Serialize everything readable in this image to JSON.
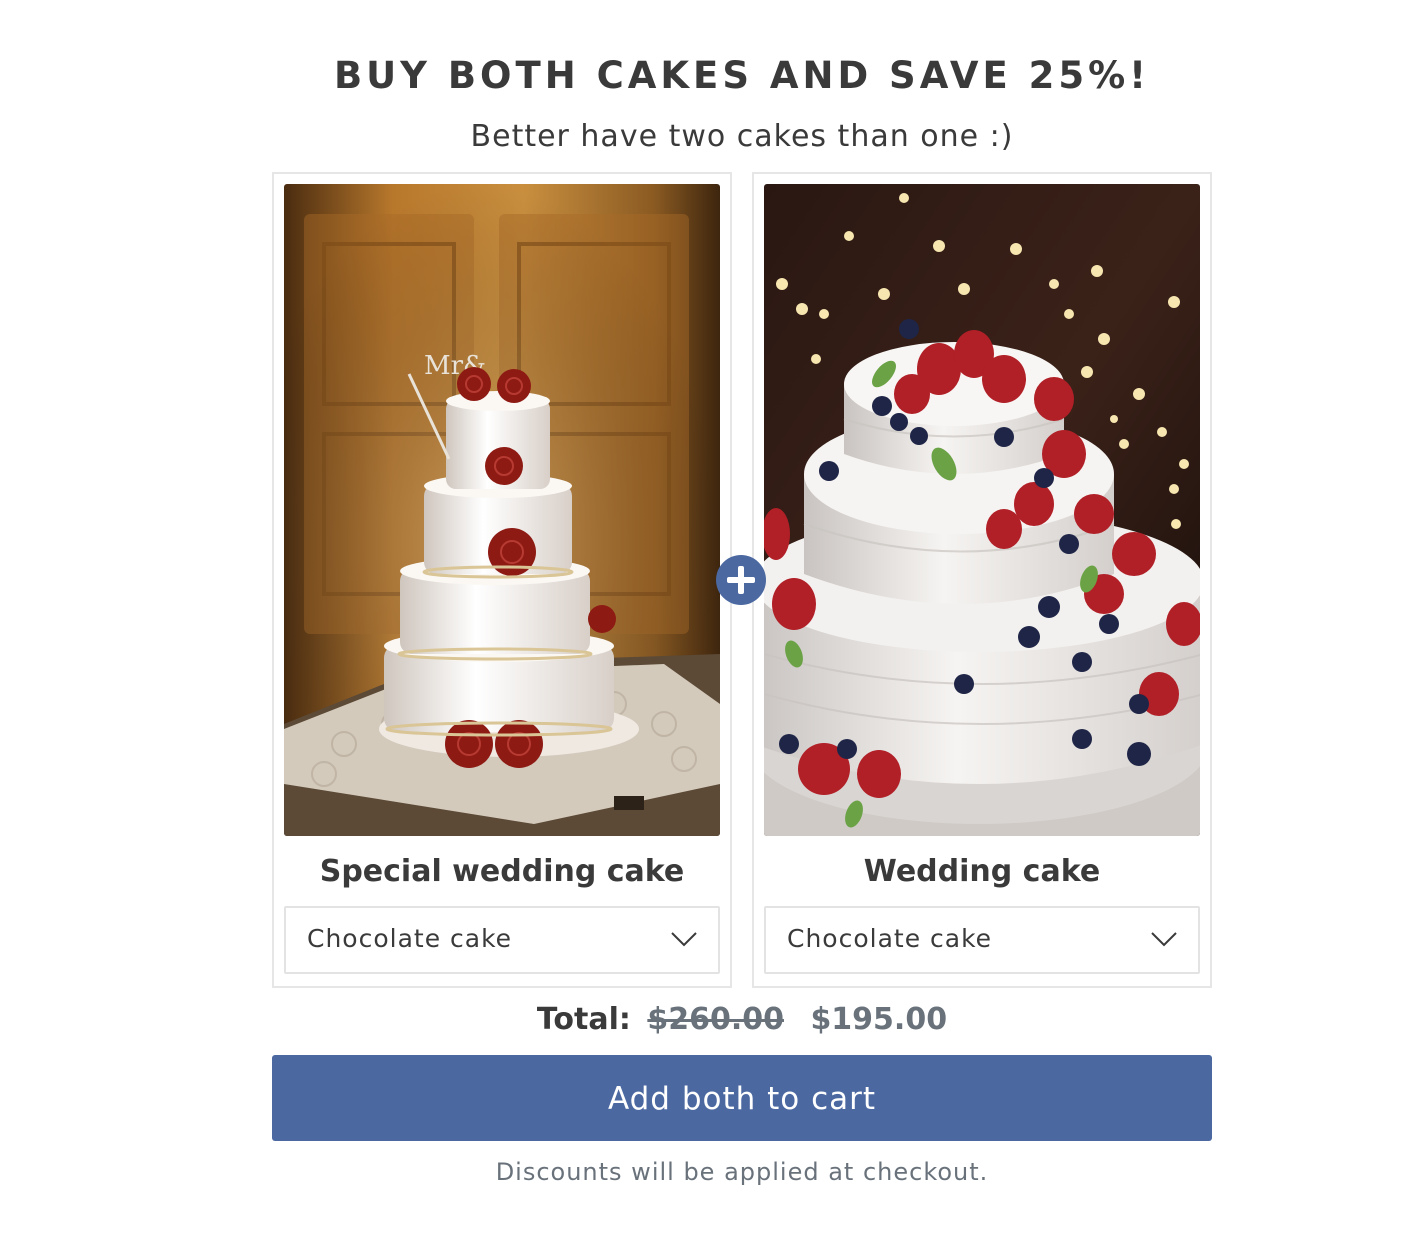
{
  "bundle": {
    "heading": "BUY BOTH CAKES AND SAVE 25%!",
    "subheading": "Better have two cakes than one :)",
    "products": [
      {
        "title": "Special wedding cake",
        "variant": "Chocolate cake",
        "image_icon": "tiered-wedding-cake-red-roses-photo"
      },
      {
        "title": "Wedding cake",
        "variant": "Chocolate cake",
        "image_icon": "white-cake-with-berries-photo"
      }
    ],
    "total": {
      "label": "Total:",
      "original_price": "$260.00",
      "discounted_price": "$195.00"
    },
    "add_button_label": "Add both to cart",
    "note": "Discounts will be applied at checkout."
  },
  "colors": {
    "accent": "#4b68a1",
    "text": "#3a3a3a",
    "muted": "#69727b",
    "border": "#e6e6e6"
  }
}
